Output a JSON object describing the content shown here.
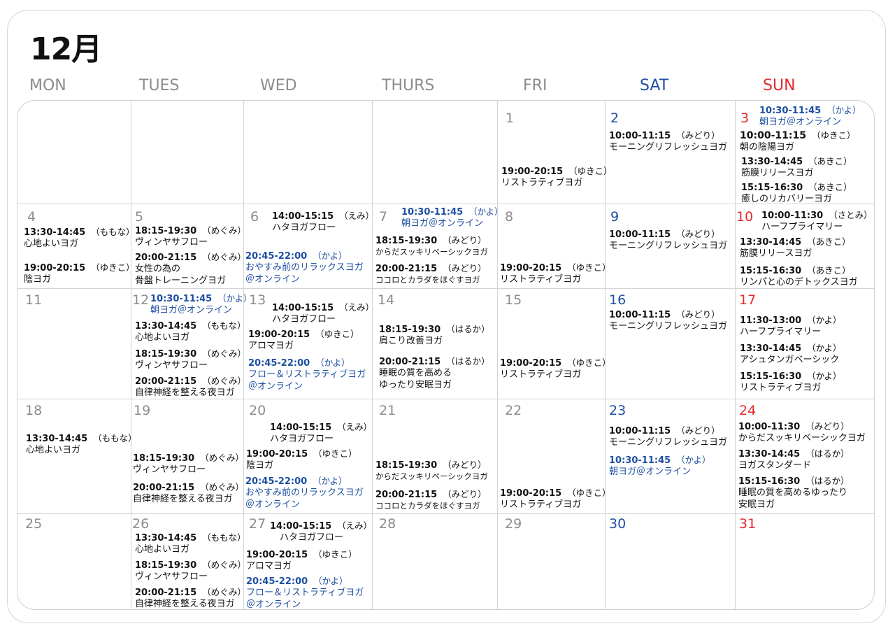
{
  "month_title": "12月",
  "weekdays": [
    "MON",
    "TUES",
    "WED",
    "THURS",
    "FRI",
    "SAT",
    "SUN"
  ],
  "days": {
    "d1": "1",
    "d2": "2",
    "d3": "3",
    "d4": "4",
    "d5": "5",
    "d6": "6",
    "d7": "7",
    "d8": "8",
    "d9": "9",
    "d10": "10",
    "d11": "11",
    "d12": "12",
    "d13": "13",
    "d14": "14",
    "d15": "15",
    "d16": "16",
    "d17": "17",
    "d18": "18",
    "d19": "19",
    "d20": "20",
    "d21": "21",
    "d22": "22",
    "d23": "23",
    "d24": "24",
    "d25": "25",
    "d26": "26",
    "d27": "27",
    "d28": "28",
    "d29": "29",
    "d30": "30",
    "d31": "31"
  },
  "events": {
    "e1": {
      "time": "19:00-20:15",
      "instructor": "（ゆきこ）",
      "name": "リストラティブヨガ"
    },
    "e2": {
      "time": "10:00-11:15",
      "instructor": "（みどり）",
      "name": "モーニングリフレッシュヨガ"
    },
    "e3a": {
      "time": "10:30-11:45",
      "instructor": "（かよ）",
      "name": "朝ヨガ＠オンライン"
    },
    "e3b": {
      "time": "10:00-11:15",
      "instructor": "（ゆきこ）",
      "name": "朝の陰陽ヨガ"
    },
    "e3c": {
      "time": "13:30-14:45",
      "instructor": "（あきこ）",
      "name": "筋膜リリースヨガ"
    },
    "e3d": {
      "time": "15:15-16:30",
      "instructor": "（あきこ）",
      "name": "癒しのリカバリーヨガ"
    },
    "e4a": {
      "time": "13:30-14:45",
      "instructor": "（ももな）",
      "name": "心地よいヨガ"
    },
    "e4b": {
      "time": "19:00-20:15",
      "instructor": "（ゆきこ）",
      "name": "陰ヨガ"
    },
    "e5a": {
      "time": "18:15-19:30",
      "instructor": "（めぐみ）",
      "name": "ヴィンヤサフロー"
    },
    "e5b": {
      "time": "20:00-21:15",
      "instructor": "（めぐみ）",
      "name": "女性の為の",
      "name2": "骨盤トレーニングヨガ"
    },
    "e6a": {
      "time": "14:00-15:15",
      "instructor": "（えみ）",
      "name": "ハタヨガフロー"
    },
    "e6b": {
      "time": "20:45-22:00",
      "instructor": "（かよ）",
      "name": "おやすみ前のリラックスヨガ",
      "name2": "＠オンライン"
    },
    "e7a": {
      "time": "10:30-11:45",
      "instructor": "（かよ）",
      "name": "朝ヨガ＠オンライン"
    },
    "e7b": {
      "time": "18:15-19:30",
      "instructor": "（みどり）",
      "name": "からだスッキリベーシックヨガ"
    },
    "e7c": {
      "time": "20:00-21:15",
      "instructor": "（みどり）",
      "name": "ココロとカラダをほぐすヨガ"
    },
    "e8": {
      "time": "19:00-20:15",
      "instructor": "（ゆきこ）",
      "name": "リストラティブヨガ"
    },
    "e9": {
      "time": "10:00-11:15",
      "instructor": "（みどり）",
      "name": "モーニングリフレッシュヨガ"
    },
    "e10a": {
      "time": "10:00-11:30",
      "instructor": "（さとみ）",
      "name": "ハーフプライマリー"
    },
    "e10b": {
      "time": "13:30-14:45",
      "instructor": "（あきこ）",
      "name": "筋膜リリースヨガ"
    },
    "e10c": {
      "time": "15:15-16:30",
      "instructor": "（あきこ）",
      "name": "リンパと心のデトックスヨガ"
    },
    "e12a": {
      "time": "10:30-11:45",
      "instructor": "（かよ）",
      "name": "朝ヨガ＠オンライン"
    },
    "e12b": {
      "time": "13:30-14:45",
      "instructor": "（ももな）",
      "name": "心地よいヨガ"
    },
    "e12c": {
      "time": "18:15-19:30",
      "instructor": "（めぐみ）",
      "name": "ヴィンヤサフロー"
    },
    "e12d": {
      "time": "20:00-21:15",
      "instructor": "（めぐみ）",
      "name": "自律神経を整える夜ヨガ"
    },
    "e13a": {
      "time": "14:00-15:15",
      "instructor": "（えみ）",
      "name": "ハタヨガフロー"
    },
    "e13b": {
      "time": "19:00-20:15",
      "instructor": "（ゆきこ）",
      "name": "アロマヨガ"
    },
    "e13c": {
      "time": "20:45-22:00",
      "instructor": "（かよ）",
      "name": "フロー＆リストラティブヨガ",
      "name2": "＠オンライン"
    },
    "e14a": {
      "time": "18:15-19:30",
      "instructor": "（はるか）",
      "name": "肩こり改善ヨガ"
    },
    "e14b": {
      "time": "20:00-21:15",
      "instructor": "（はるか）",
      "name": "睡眠の質を高める",
      "name2": "ゆったり安眠ヨガ"
    },
    "e15": {
      "time": "19:00-20:15",
      "instructor": "（ゆきこ）",
      "name": "リストラティブヨガ"
    },
    "e16": {
      "time": "10:00-11:15",
      "instructor": "（みどり）",
      "name": "モーニングリフレッシュヨガ"
    },
    "e17a": {
      "time": "11:30-13:00",
      "instructor": "（かよ）",
      "name": "ハーフプライマリー"
    },
    "e17b": {
      "time": "13:30-14:45",
      "instructor": "（かよ）",
      "name": "アシュタンガベーシック"
    },
    "e17c": {
      "time": "15:15-16:30",
      "instructor": "（かよ）",
      "name": "リストラティブヨガ"
    },
    "e18": {
      "time": "13:30-14:45",
      "instructor": "（ももな）",
      "name": "心地よいヨガ"
    },
    "e19a": {
      "time": "18:15-19:30",
      "instructor": "（めぐみ）",
      "name": "ヴィンヤサフロー"
    },
    "e19b": {
      "time": "20:00-21:15",
      "instructor": "（めぐみ）",
      "name": "自律神経を整える夜ヨガ"
    },
    "e20a": {
      "time": "14:00-15:15",
      "instructor": "（えみ）",
      "name": "ハタヨガフロー"
    },
    "e20b": {
      "time": "19:00-20:15",
      "instructor": "（ゆきこ）",
      "name": "陰ヨガ"
    },
    "e20c": {
      "time": "20:45-22:00",
      "instructor": "（かよ）",
      "name": "おやすみ前のリラックスヨガ",
      "name2": "＠オンライン"
    },
    "e21a": {
      "time": "18:15-19:30",
      "instructor": "（みどり）",
      "name": "からだスッキリベーシックヨガ"
    },
    "e21b": {
      "time": "20:00-21:15",
      "instructor": "（みどり）",
      "name": "ココロとカラダをほぐすヨガ"
    },
    "e22": {
      "time": "19:00-20:15",
      "instructor": "（ゆきこ）",
      "name": "リストラティブヨガ"
    },
    "e23a": {
      "time": "10:00-11:15",
      "instructor": "（みどり）",
      "name": "モーニングリフレッシュヨガ"
    },
    "e23b": {
      "time": "10:30-11:45",
      "instructor": "（かよ）",
      "name": "朝ヨガ＠オンライン"
    },
    "e24a": {
      "time": "10:00-11:30",
      "instructor": "（みどり）",
      "name": "からだスッキリベーシックヨガ"
    },
    "e24b": {
      "time": "13:30-14:45",
      "instructor": "（はるか）",
      "name": "ヨガスタンダード"
    },
    "e24c": {
      "time": "15:15-16:30",
      "instructor": "（はるか）",
      "name": "睡眠の質を高めるゆったり",
      "name2": "安眠ヨガ"
    },
    "e26a": {
      "time": "13:30-14:45",
      "instructor": "（ももな）",
      "name": "心地よいヨガ"
    },
    "e26b": {
      "time": "18:15-19:30",
      "instructor": "（めぐみ）",
      "name": "ヴィンヤサフロー"
    },
    "e26c": {
      "time": "20:00-21:15",
      "instructor": "（めぐみ）",
      "name": "自律神経を整える夜ヨガ"
    },
    "e27a": {
      "time": "14:00-15:15",
      "instructor": "（えみ）",
      "name": "ハタヨガフロー"
    },
    "e27b": {
      "time": "19:00-20:15",
      "instructor": "（ゆきこ）",
      "name": "アロマヨガ"
    },
    "e27c": {
      "time": "20:45-22:00",
      "instructor": "（かよ）",
      "name": "フロー＆リストラティブヨガ",
      "name2": "＠オンライン"
    }
  },
  "colors": {
    "weekday": "#8c8c8c",
    "saturday": "#1d4fa2",
    "sunday": "#e8282b",
    "online": "#1d4fa2",
    "text": "#111111"
  }
}
